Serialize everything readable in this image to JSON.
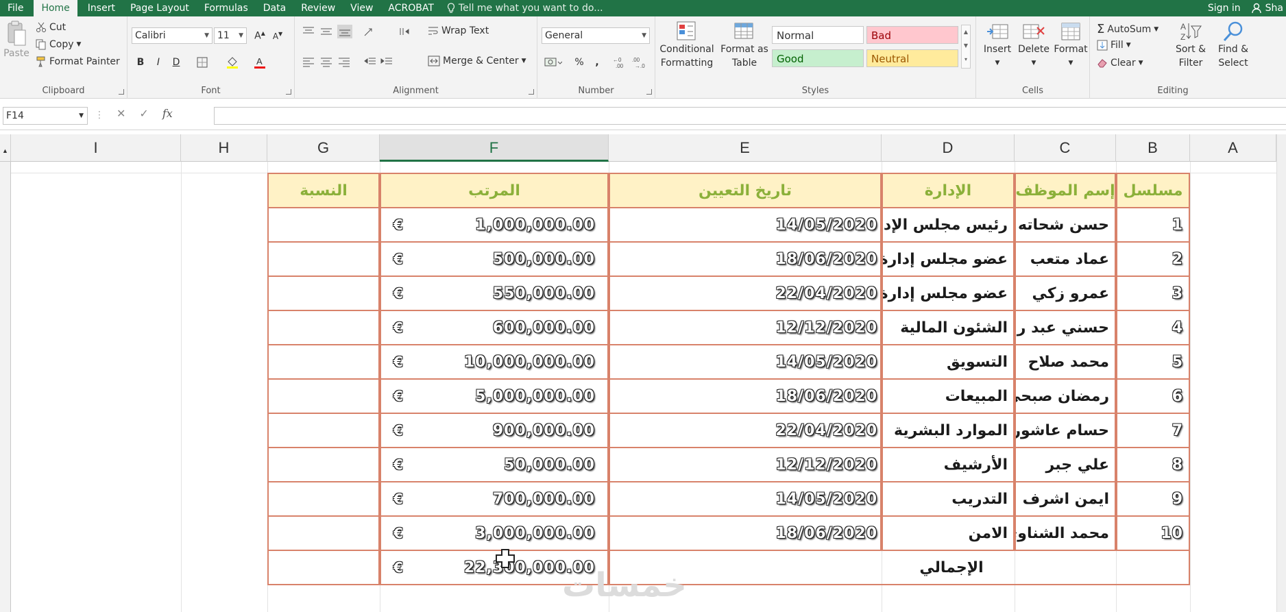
{
  "menu": {
    "tabs": [
      "File",
      "Home",
      "Insert",
      "Page Layout",
      "Formulas",
      "Data",
      "Review",
      "View",
      "ACROBAT"
    ],
    "tell_me": "Tell me what you want to do...",
    "sign_in": "Sign in",
    "share": "Sha"
  },
  "ribbon": {
    "clipboard": {
      "paste": "Paste",
      "cut": "Cut",
      "copy": "Copy",
      "format_painter": "Format Painter",
      "label": "Clipboard"
    },
    "font": {
      "name": "Calibri",
      "size": "11",
      "label": "Font"
    },
    "alignment": {
      "wrap_text": "Wrap Text",
      "merge_center": "Merge & Center",
      "label": "Alignment"
    },
    "number": {
      "format": "General",
      "percent": "%",
      "comma": ",",
      "label": "Number"
    },
    "styles": {
      "conditional_formatting": "Conditional Formatting",
      "format_as_table": "Format as Table",
      "normal": "Normal",
      "bad": "Bad",
      "good": "Good",
      "neutral": "Neutral",
      "label": "Styles"
    },
    "cells": {
      "insert": "Insert",
      "delete": "Delete",
      "format": "Format",
      "label": "Cells"
    },
    "editing": {
      "autosum": "AutoSum",
      "fill": "Fill",
      "clear": "Clear",
      "sort_filter": "Sort & Filter",
      "find_select": "Find & Select",
      "label": "Editing"
    }
  },
  "formula_bar": {
    "name_box": "F14",
    "fx": "fx",
    "cancel": "✕",
    "enter": "✓",
    "value": ""
  },
  "columns": [
    "I",
    "H",
    "G",
    "F",
    "E",
    "D",
    "C",
    "B",
    "A"
  ],
  "selected_column": "F",
  "table": {
    "headers": {
      "serial": "مسلسل",
      "employee": "إسم الموظف",
      "department": "الإدارة",
      "hire_date": "تاريخ التعيين",
      "salary": "المرتب",
      "percent": "النسبة"
    },
    "currency_symbol": "€",
    "rows": [
      {
        "serial": "1",
        "employee": "حسن شحاته",
        "department": "رئيس مجلس الإدارة",
        "hire_date": "14/05/2020",
        "salary": "1,000,000.00"
      },
      {
        "serial": "2",
        "employee": "عماد متعب",
        "department": "عضو مجلس إدارة",
        "hire_date": "18/06/2020",
        "salary": "500,000.00"
      },
      {
        "serial": "3",
        "employee": "عمرو زكي",
        "department": "عضو مجلس إدارة",
        "hire_date": "22/04/2020",
        "salary": "550,000.00"
      },
      {
        "serial": "4",
        "employee": "حسني عبد ربه",
        "department": "الشئون المالية",
        "hire_date": "12/12/2020",
        "salary": "600,000.00"
      },
      {
        "serial": "5",
        "employee": "محمد صلاح",
        "department": "التسويق",
        "hire_date": "14/05/2020",
        "salary": "10,000,000.00"
      },
      {
        "serial": "6",
        "employee": "رمضان صبحي",
        "department": "المبيعات",
        "hire_date": "18/06/2020",
        "salary": "5,000,000.00"
      },
      {
        "serial": "7",
        "employee": "حسام عاشور",
        "department": "الموارد البشرية",
        "hire_date": "22/04/2020",
        "salary": "900,000.00"
      },
      {
        "serial": "8",
        "employee": "علي جبر",
        "department": "الأرشيف",
        "hire_date": "12/12/2020",
        "salary": "50,000.00"
      },
      {
        "serial": "9",
        "employee": "ايمن اشرف",
        "department": "التدريب",
        "hire_date": "14/05/2020",
        "salary": "700,000.00"
      },
      {
        "serial": "10",
        "employee": "محمد الشناوي",
        "department": "الامن",
        "hire_date": "18/06/2020",
        "salary": "3,000,000.00"
      }
    ],
    "total_label": "الإجمالي",
    "total_value": "22,300,000.00"
  },
  "watermark": "خمسات",
  "colors": {
    "accent": "#217346",
    "header_fill": "#fff2c6",
    "header_text": "#8bb03a",
    "border": "#d8826a"
  }
}
